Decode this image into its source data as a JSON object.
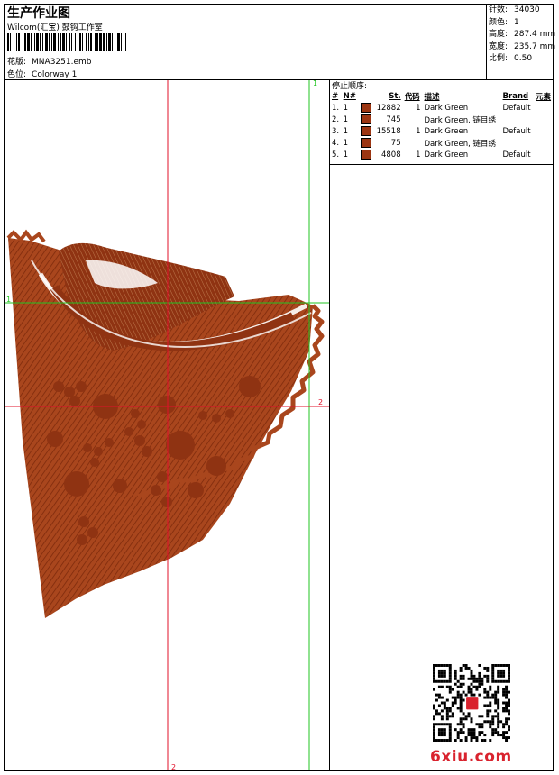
{
  "header": {
    "title": "生产作业图",
    "subtitle": "Wilcom(汇宝) 鼓钩工作室",
    "file_label": "花版:",
    "file_value": "MNA3251.emb",
    "colorway_label": "色位:",
    "colorway_value": "Colorway 1"
  },
  "stats": [
    {
      "label": "针数:",
      "value": "34030"
    },
    {
      "label": "颜色:",
      "value": "1"
    },
    {
      "label": "高度:",
      "value": "287.4 mm"
    },
    {
      "label": "宽度:",
      "value": "235.7 mm"
    },
    {
      "label": "比例:",
      "value": "0.50"
    }
  ],
  "sequence": {
    "title": "停止顺序:",
    "columns": [
      "#",
      "N#",
      "St.",
      "代码",
      "描述",
      "Brand",
      "元素"
    ],
    "rows": [
      {
        "idx": "1.",
        "n": "1",
        "st": "12882",
        "code": "1",
        "desc": "Dark Green",
        "brand": "Default",
        "color": "#9b3512"
      },
      {
        "idx": "2.",
        "n": "1",
        "st": "745",
        "code": "",
        "desc": "Dark Green, 链目绣",
        "brand": "",
        "color": "#9b3512"
      },
      {
        "idx": "3.",
        "n": "1",
        "st": "15518",
        "code": "1",
        "desc": "Dark Green",
        "brand": "Default",
        "color": "#9b3512"
      },
      {
        "idx": "4.",
        "n": "1",
        "st": "75",
        "code": "",
        "desc": "Dark Green, 链目绣",
        "brand": "",
        "color": "#9b3512"
      },
      {
        "idx": "5.",
        "n": "1",
        "st": "4808",
        "code": "1",
        "desc": "Dark Green",
        "brand": "Default",
        "color": "#9b3512"
      }
    ]
  },
  "guides": {
    "green_top": "1",
    "green_left": "1",
    "red_right": "2",
    "red_bottom": "2"
  },
  "colors": {
    "thread": "#9b3512",
    "guide_green": "#22c422",
    "guide_red": "#e0102a",
    "watermark": "#d9232e"
  },
  "watermark": "6xiu.com"
}
